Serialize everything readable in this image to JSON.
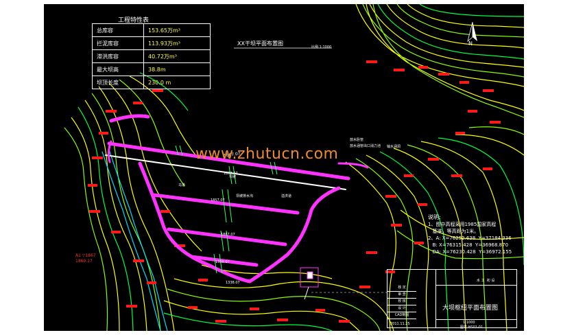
{
  "plan_title": "XX干坝平面布置图",
  "scale_label": "比例 1:1000",
  "watermark": "www.zhutucn.com",
  "north_label": "N",
  "engineering_table": {
    "title": "工程特性表",
    "rows": [
      {
        "label": "总库容",
        "value": "153.65万m³"
      },
      {
        "label": "拦泥库容",
        "value": "113.93万m³"
      },
      {
        "label": "滞洪库容",
        "value": "40.72万m³"
      },
      {
        "label": "最大坝高",
        "value": "38.8m"
      },
      {
        "label": "坝顶长度",
        "value": "230.0 m"
      }
    ]
  },
  "notes": {
    "title": "说明:",
    "lines": [
      "1、图中高程采用1985国家高程",
      "   基准，等高距为1米。",
      "2、A: X=76252.638  Y=37184.336",
      "   B: X=76315.428  Y=36968.870",
      "   DA: X=76230.428  Y=36972.155"
    ]
  },
  "annotations": {
    "crest": "1867.07",
    "berm1": "1867.07",
    "berm2": "1857.07",
    "berm3": "1867.07",
    "berm4": "1338.07",
    "toe": "1338.07",
    "drain": "坝坡排水沟",
    "slope": "坝坡",
    "horse_track": "马道",
    "spillway": "溢洪道",
    "outlet1": "放水卧管",
    "outlet2": "放水涵管出口消力池",
    "intake": "输水涵洞",
    "left_a": "A1 ▽1867",
    "left_b": "1860.17"
  },
  "title_block": {
    "drawing_name": "大坝枢纽平面布置图",
    "rows": [
      "核 定",
      "审 查",
      "校 核",
      "设 计",
      "CAD制图"
    ],
    "dept": "水 工",
    "part": "初 设",
    "scale": "1:1000",
    "date": "2011.11.25",
    "drawing_no": "图号:HS01-01"
  }
}
